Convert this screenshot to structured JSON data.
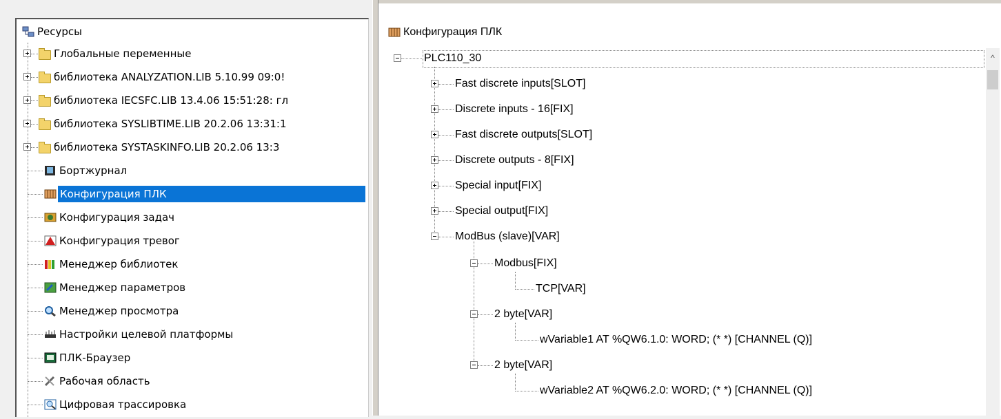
{
  "left_tree": {
    "root": "Ресурсы",
    "items": [
      {
        "label": "Глобальные переменные",
        "icon": "folder-icon",
        "expandable": true
      },
      {
        "label": "библиотека ANALYZATION.LIB 5.10.99 09:0!",
        "icon": "folder-icon",
        "expandable": true
      },
      {
        "label": "библиотека IECSFC.LIB 13.4.06 15:51:28: гл",
        "icon": "folder-icon",
        "expandable": true
      },
      {
        "label": "библиотека SYSLIBTIME.LIB 20.2.06 13:31:1",
        "icon": "folder-icon",
        "expandable": true
      },
      {
        "label": "библиотека SYSTASKINFO.LIB 20.2.06 13:3",
        "icon": "folder-icon",
        "expandable": true
      },
      {
        "label": "Бортжурнал",
        "icon": "logbook-icon",
        "expandable": false
      },
      {
        "label": "Конфигурация ПЛК",
        "icon": "plc-config-icon",
        "expandable": false,
        "selected": true
      },
      {
        "label": "Конфигурация задач",
        "icon": "task-config-icon",
        "expandable": false
      },
      {
        "label": "Конфигурация тревог",
        "icon": "alarm-config-icon",
        "expandable": false
      },
      {
        "label": "Менеджер библиотек",
        "icon": "library-manager-icon",
        "expandable": false
      },
      {
        "label": "Менеджер параметров",
        "icon": "parameter-manager-icon",
        "expandable": false
      },
      {
        "label": "Менеджер просмотра",
        "icon": "watch-manager-icon",
        "expandable": false
      },
      {
        "label": "Настройки целевой платформы",
        "icon": "target-settings-icon",
        "expandable": false
      },
      {
        "label": "ПЛК-Браузер",
        "icon": "plc-browser-icon",
        "expandable": false
      },
      {
        "label": "Рабочая область",
        "icon": "workspace-icon",
        "expandable": false
      },
      {
        "label": "Цифровая трассировка",
        "icon": "sampling-trace-icon",
        "expandable": false
      }
    ]
  },
  "right_panel": {
    "title": "Конфигурация ПЛК",
    "root": "PLC110_30",
    "nodes": [
      {
        "label": "Fast discrete inputs[SLOT]"
      },
      {
        "label": "Discrete inputs - 16[FIX]"
      },
      {
        "label": "Fast discrete outputs[SLOT]"
      },
      {
        "label": "Discrete outputs - 8[FIX]"
      },
      {
        "label": "Special input[FIX]"
      },
      {
        "label": "Special output[FIX]"
      },
      {
        "label": "ModBus (slave)[VAR]"
      },
      {
        "label": "Modbus[FIX]"
      },
      {
        "label": "TCP[VAR]"
      },
      {
        "label": "2 byte[VAR]"
      },
      {
        "label": "wVariable1 AT %QW6.1.0: WORD; (*  *) [CHANNEL (Q)]"
      },
      {
        "label": "2 byte[VAR]"
      },
      {
        "label": "wVariable2 AT %QW6.2.0: WORD; (*  *) [CHANNEL (Q)]"
      }
    ]
  },
  "colors": {
    "selection": "#0a74d6",
    "folder": "#f3d36a"
  }
}
